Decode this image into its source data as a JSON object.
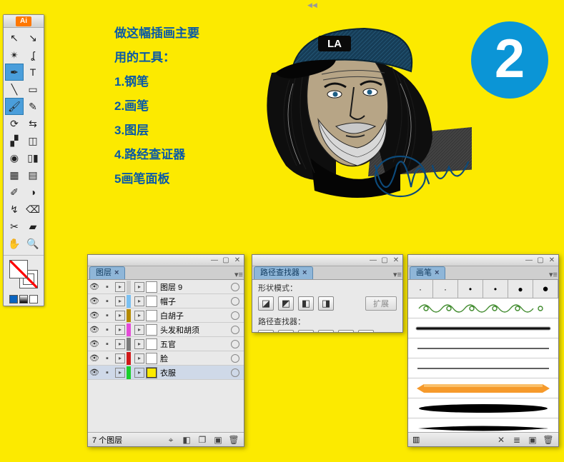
{
  "app_badge": "Ai",
  "badge_number": "2",
  "instructions": {
    "line1": "做这幅插画主要",
    "line2": "用的工具：",
    "line3": "1.钢笔",
    "line4": "2.画笔",
    "line5": "3.图层",
    "line6": "4.路经查证器",
    "line7": "5画笔面板"
  },
  "layers_panel": {
    "tab": "图层",
    "items": [
      {
        "name": "图层 9",
        "color": "#cccccc"
      },
      {
        "name": "帽子",
        "color": "#7ac0f2"
      },
      {
        "name": "白胡子",
        "color": "#b48a00"
      },
      {
        "name": "头发和胡须",
        "color": "#e44ad8"
      },
      {
        "name": "五官",
        "color": "#7b7b7b"
      },
      {
        "name": "脸",
        "color": "#d01818"
      },
      {
        "name": "衣服",
        "color": "#1bcf2d",
        "selected": true
      }
    ],
    "footer": "7 个图层"
  },
  "pathfinder_panel": {
    "tab": "路径查找器",
    "shape_modes": "形状模式：",
    "expand": "扩展",
    "pathfinders": "路径查找器："
  },
  "brushes_panel": {
    "tab": "画笔"
  }
}
